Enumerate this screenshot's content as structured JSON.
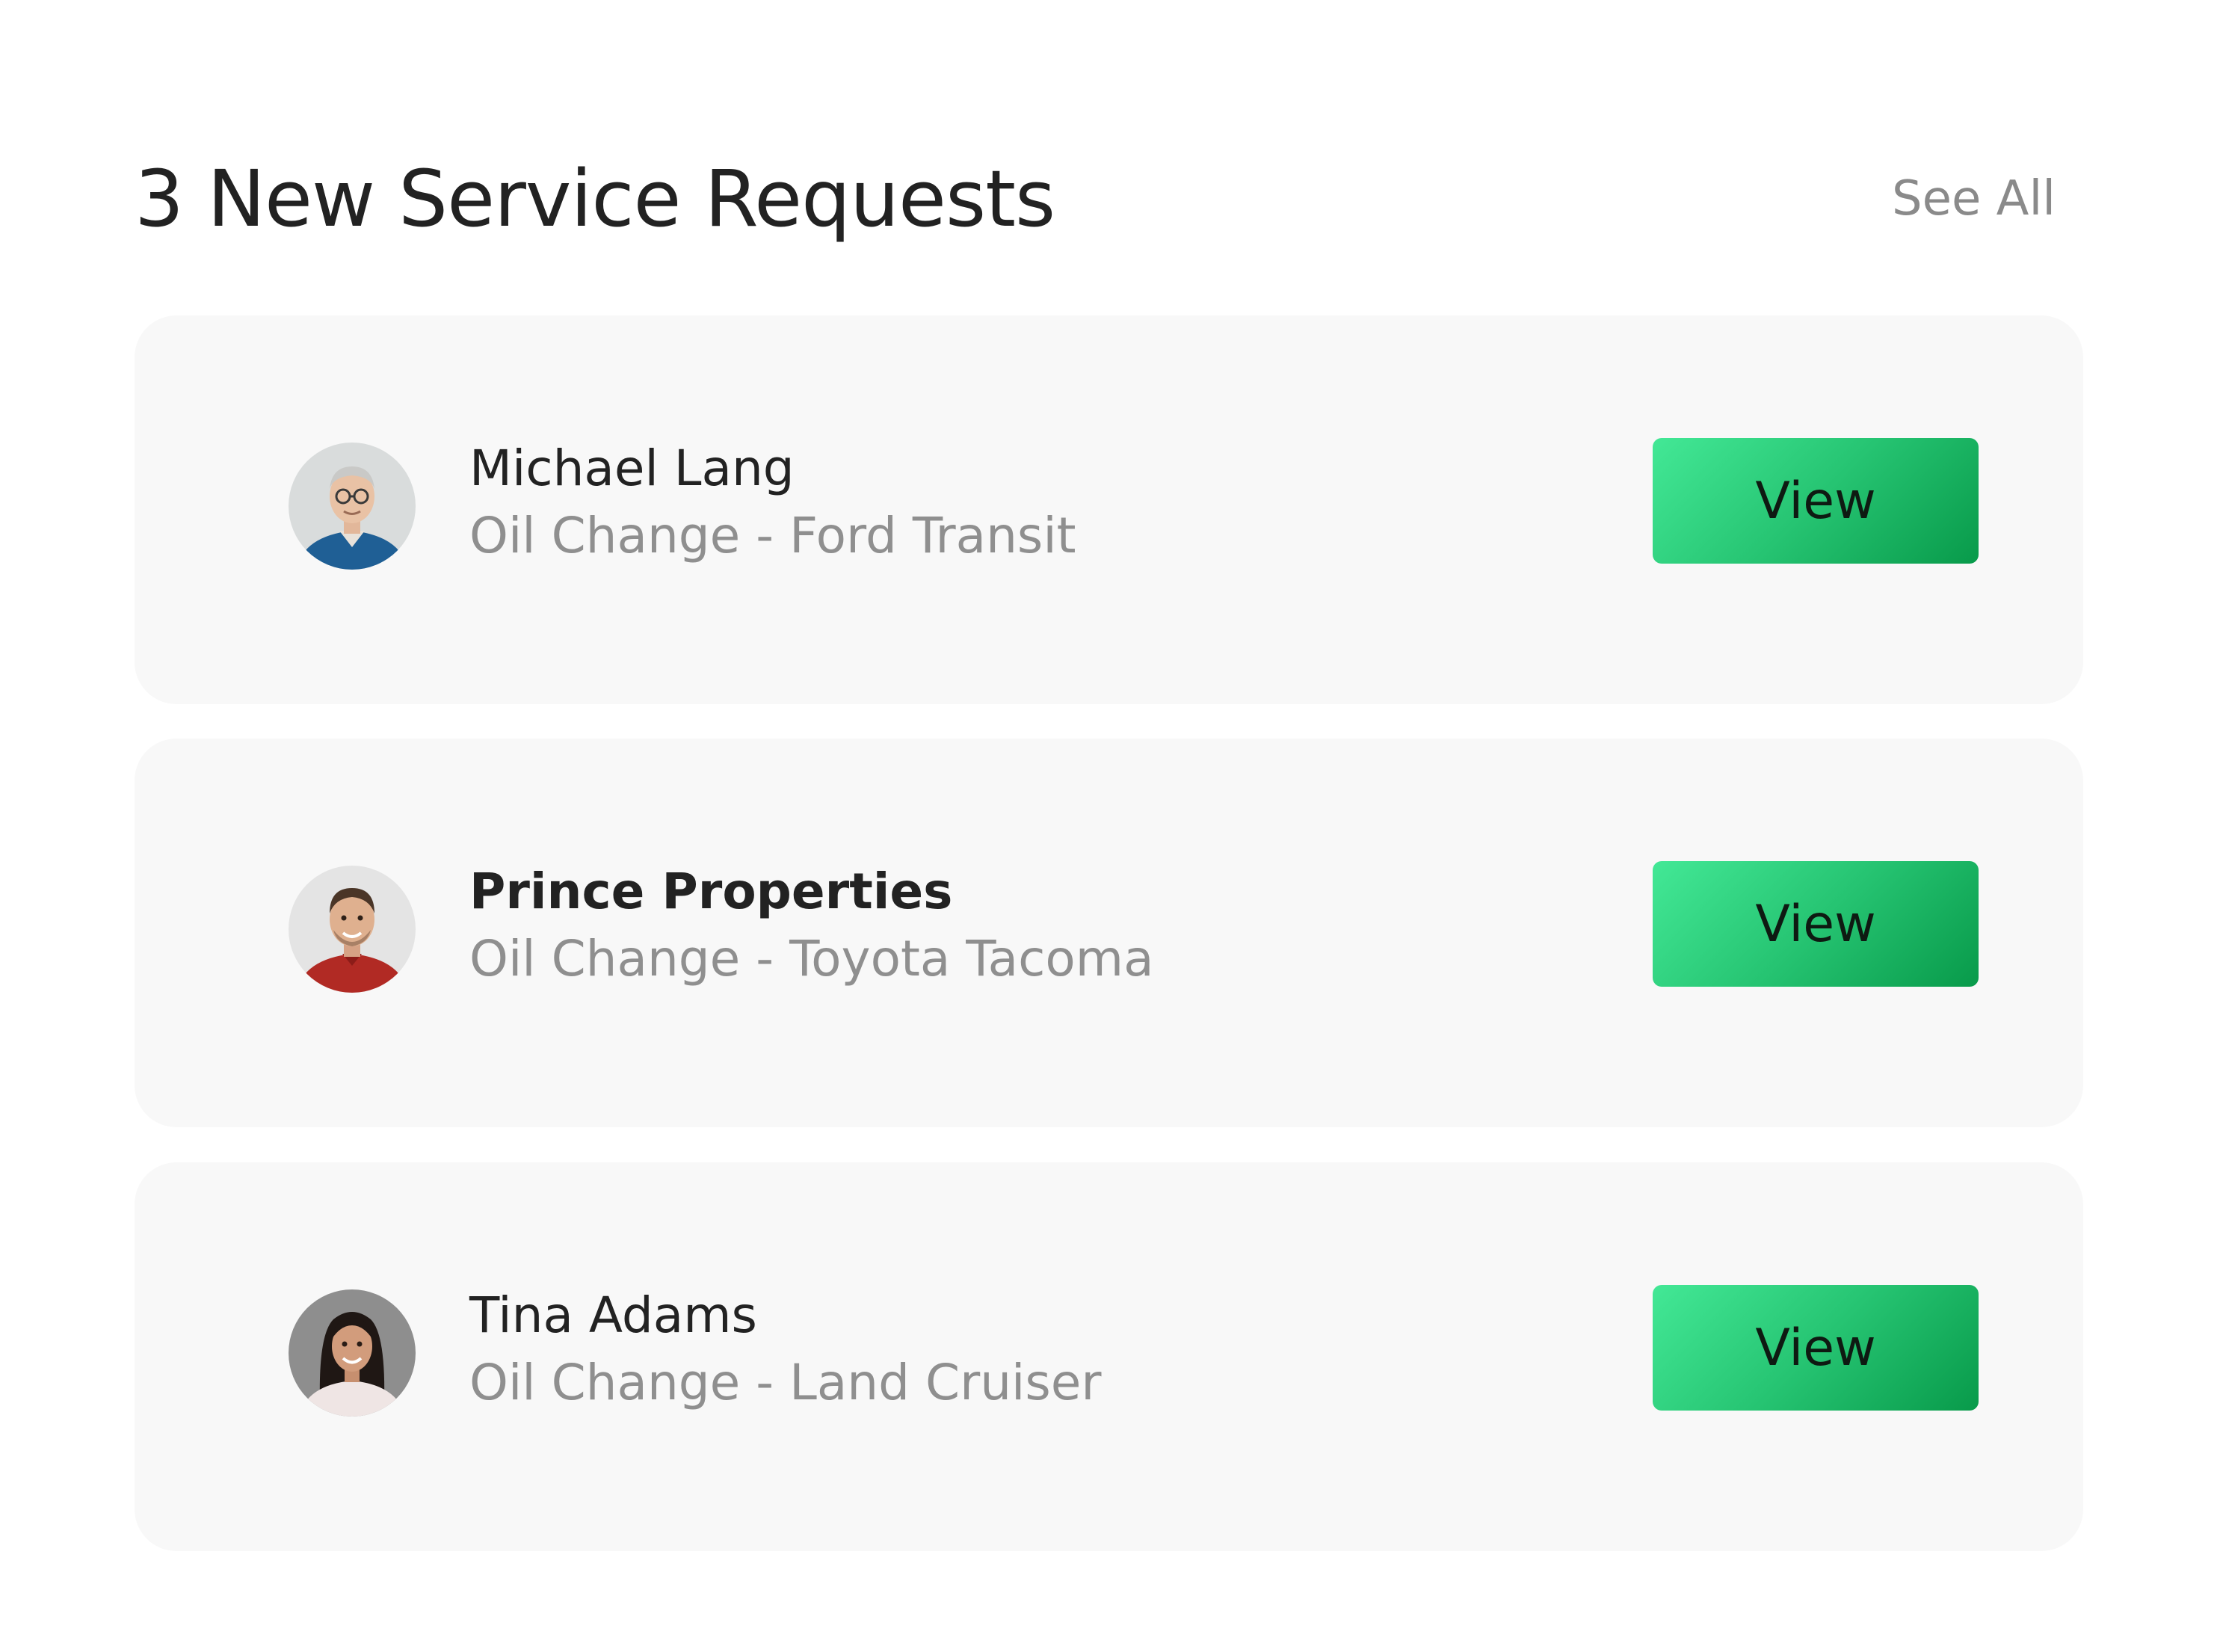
{
  "header": {
    "title": "3 New Service Requests",
    "see_all_label": "See All"
  },
  "requests": [
    {
      "name": "Michael Lang",
      "service": "Oil Change - Ford Transit",
      "button_label": "View",
      "avatar": "avatar-photo"
    },
    {
      "name": "Prince Properties",
      "service": "Oil Change - Toyota Tacoma",
      "button_label": "View",
      "avatar": "avatar-photo"
    },
    {
      "name": "Tina Adams",
      "service": "Oil Change - Land Cruiser",
      "button_label": "View",
      "avatar": "avatar-photo"
    }
  ],
  "colors": {
    "accent_start": "#43e896",
    "accent_end": "#089a4a",
    "card_background": "#f8f8f8",
    "title_text": "#222222",
    "secondary_text": "#8f8f8f"
  }
}
